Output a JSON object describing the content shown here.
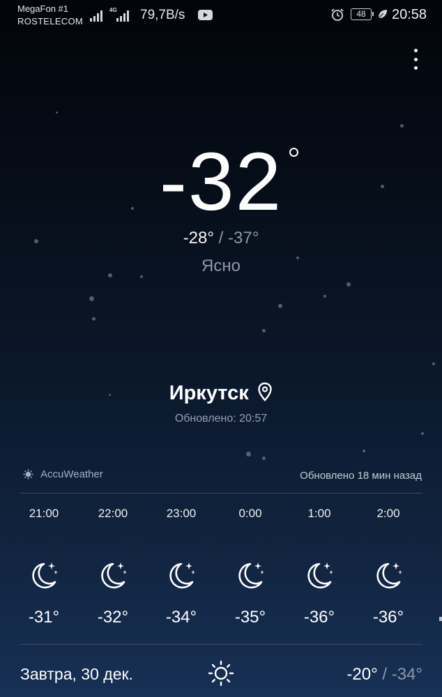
{
  "status_bar": {
    "carrier_1": "MegaFon #1",
    "carrier_2": "ROSTELECOM",
    "network_badge": "4G",
    "net_speed": "79,7B/s",
    "battery": "48",
    "time": "20:58",
    "icons": [
      "signal-icon",
      "signal-4g-icon",
      "youtube-icon",
      "alarm-icon",
      "battery-icon",
      "leaf-icon"
    ]
  },
  "current": {
    "temperature": "-32",
    "high": "-28°",
    "separator": "/",
    "low": "-37°",
    "condition": "Ясно"
  },
  "location": {
    "city": "Иркутск",
    "updated": "Обновлено: 20:57"
  },
  "provider": {
    "name": "AccuWeather",
    "updated": "Обновлено 18 мин назад"
  },
  "hourly": [
    {
      "time": "21:00",
      "icon": "moon-stars-icon",
      "temp": "-31°"
    },
    {
      "time": "22:00",
      "icon": "moon-stars-icon",
      "temp": "-32°"
    },
    {
      "time": "23:00",
      "icon": "moon-stars-icon",
      "temp": "-34°"
    },
    {
      "time": "0:00",
      "icon": "moon-stars-icon",
      "temp": "-35°"
    },
    {
      "time": "1:00",
      "icon": "moon-stars-icon",
      "temp": "-36°"
    },
    {
      "time": "2:00",
      "icon": "moon-stars-icon",
      "temp": "-36°"
    }
  ],
  "tomorrow": {
    "label": "Завтра, 30 дек.",
    "icon": "sun-icon",
    "high": "-20°",
    "separator": "/",
    "low": "-34°"
  },
  "colors": {
    "background_top": "#02050a",
    "background_bottom": "#173055",
    "muted_text": "#8d98aa",
    "divider": "#3b4a62"
  }
}
